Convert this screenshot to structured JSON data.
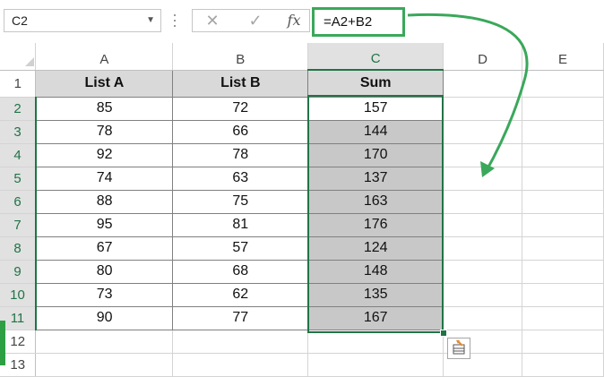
{
  "formula_bar": {
    "name_box": "C2",
    "name_box_dropdown": "▼",
    "cancel_icon": "✕",
    "enter_icon": "✓",
    "fx_label": "fx",
    "formula": "=A2+B2"
  },
  "columns": [
    "A",
    "B",
    "C",
    "D",
    "E"
  ],
  "rows": [
    "1",
    "2",
    "3",
    "4",
    "5",
    "6",
    "7",
    "8",
    "9",
    "10",
    "11",
    "12",
    "13"
  ],
  "table": {
    "headers": [
      "List A",
      "List B",
      "Sum"
    ],
    "data": [
      [
        "85",
        "72",
        "157"
      ],
      [
        "78",
        "66",
        "144"
      ],
      [
        "92",
        "78",
        "170"
      ],
      [
        "74",
        "63",
        "137"
      ],
      [
        "88",
        "75",
        "163"
      ],
      [
        "95",
        "81",
        "176"
      ],
      [
        "67",
        "57",
        "124"
      ],
      [
        "80",
        "68",
        "148"
      ],
      [
        "73",
        "62",
        "135"
      ],
      [
        "90",
        "77",
        "167"
      ]
    ]
  },
  "colors": {
    "selection": "#217346",
    "highlight_box": "#3aa85a",
    "sum_fill": "#c8c8c8",
    "header_fill": "#d9d9d9"
  }
}
